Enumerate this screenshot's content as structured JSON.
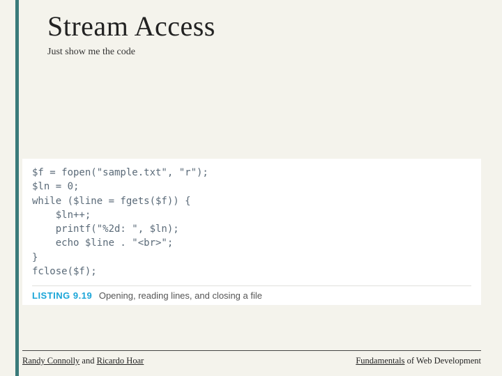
{
  "header": {
    "title": "Stream Access",
    "subtitle": "Just show me the code"
  },
  "code": {
    "lines": [
      "$f = fopen(\"sample.txt\", \"r\");",
      "$ln = 0;",
      "while ($line = fgets($f)) {",
      "    $ln++;",
      "    printf(\"%2d: \", $ln);",
      "    echo $line . \"<br>\";",
      "}",
      "fclose($f);"
    ],
    "caption_label": "LISTING 9.19",
    "caption_text": "Opening, reading lines, and closing a file"
  },
  "footer": {
    "left_parts": [
      "Randy Connolly",
      " and ",
      "Ricardo Hoar"
    ],
    "right_parts": [
      "Fundamentals",
      " of Web Development"
    ]
  }
}
